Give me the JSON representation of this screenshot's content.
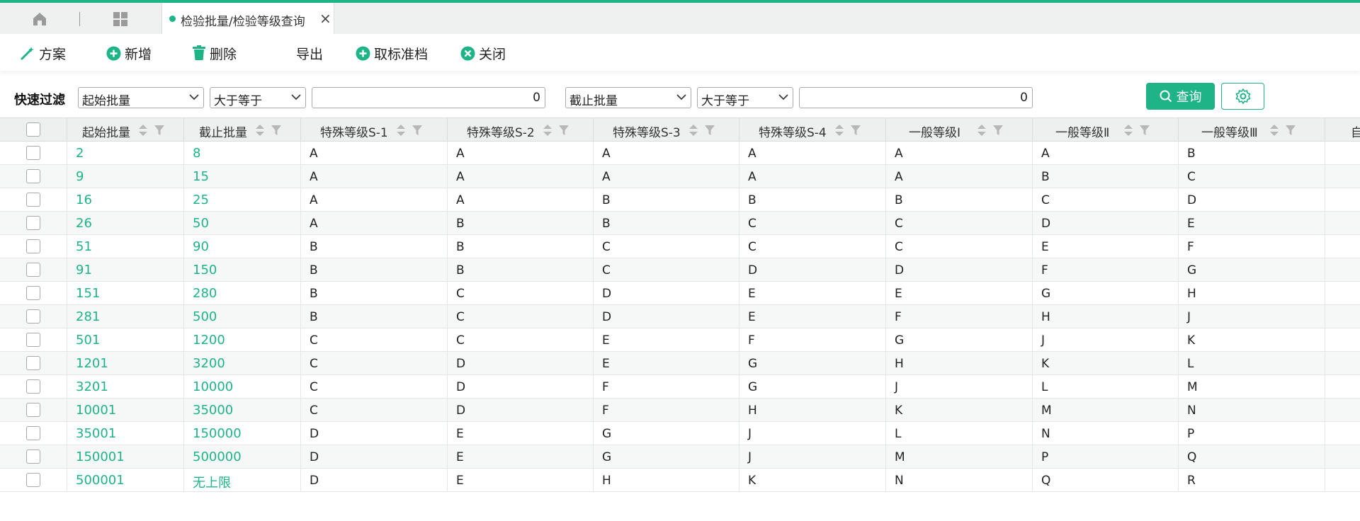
{
  "tabs": {
    "home_icon": "home-icon",
    "apps_icon": "grid-icon",
    "active_tab": "检验批量/检验等级查询",
    "close": "×"
  },
  "toolbar": {
    "scheme": "方案",
    "add": "新增",
    "delete": "删除",
    "export": "导出",
    "cancel_standard": "取标准档",
    "close": "关闭"
  },
  "filter": {
    "label": "快速过滤",
    "field1": "起始批量",
    "op1": "大于等于",
    "value1": "0",
    "field2": "截止批量",
    "op2": "大于等于",
    "value2": "0",
    "query": "查询"
  },
  "accent": "#1fb488",
  "table": {
    "columns": [
      "起始批量",
      "截止批量",
      "特殊等级S-1",
      "特殊等级S-2",
      "特殊等级S-3",
      "特殊等级S-4",
      "一般等级Ⅰ",
      "一般等级Ⅱ",
      "一般等级Ⅲ",
      "自"
    ],
    "rows": [
      [
        "2",
        "8",
        "A",
        "A",
        "A",
        "A",
        "A",
        "A",
        "B"
      ],
      [
        "9",
        "15",
        "A",
        "A",
        "A",
        "A",
        "A",
        "B",
        "C"
      ],
      [
        "16",
        "25",
        "A",
        "A",
        "B",
        "B",
        "B",
        "C",
        "D"
      ],
      [
        "26",
        "50",
        "A",
        "B",
        "B",
        "C",
        "C",
        "D",
        "E"
      ],
      [
        "51",
        "90",
        "B",
        "B",
        "C",
        "C",
        "C",
        "E",
        "F"
      ],
      [
        "91",
        "150",
        "B",
        "B",
        "C",
        "D",
        "D",
        "F",
        "G"
      ],
      [
        "151",
        "280",
        "B",
        "C",
        "D",
        "E",
        "E",
        "G",
        "H"
      ],
      [
        "281",
        "500",
        "B",
        "C",
        "D",
        "E",
        "F",
        "H",
        "J"
      ],
      [
        "501",
        "1200",
        "C",
        "C",
        "E",
        "F",
        "G",
        "J",
        "K"
      ],
      [
        "1201",
        "3200",
        "C",
        "D",
        "E",
        "G",
        "H",
        "K",
        "L"
      ],
      [
        "3201",
        "10000",
        "C",
        "D",
        "F",
        "G",
        "J",
        "L",
        "M"
      ],
      [
        "10001",
        "35000",
        "C",
        "D",
        "F",
        "H",
        "K",
        "M",
        "N"
      ],
      [
        "35001",
        "150000",
        "D",
        "E",
        "G",
        "J",
        "L",
        "N",
        "P"
      ],
      [
        "150001",
        "500000",
        "D",
        "E",
        "G",
        "J",
        "M",
        "P",
        "Q"
      ],
      [
        "500001",
        "无上限",
        "D",
        "E",
        "H",
        "K",
        "N",
        "Q",
        "R"
      ]
    ]
  }
}
